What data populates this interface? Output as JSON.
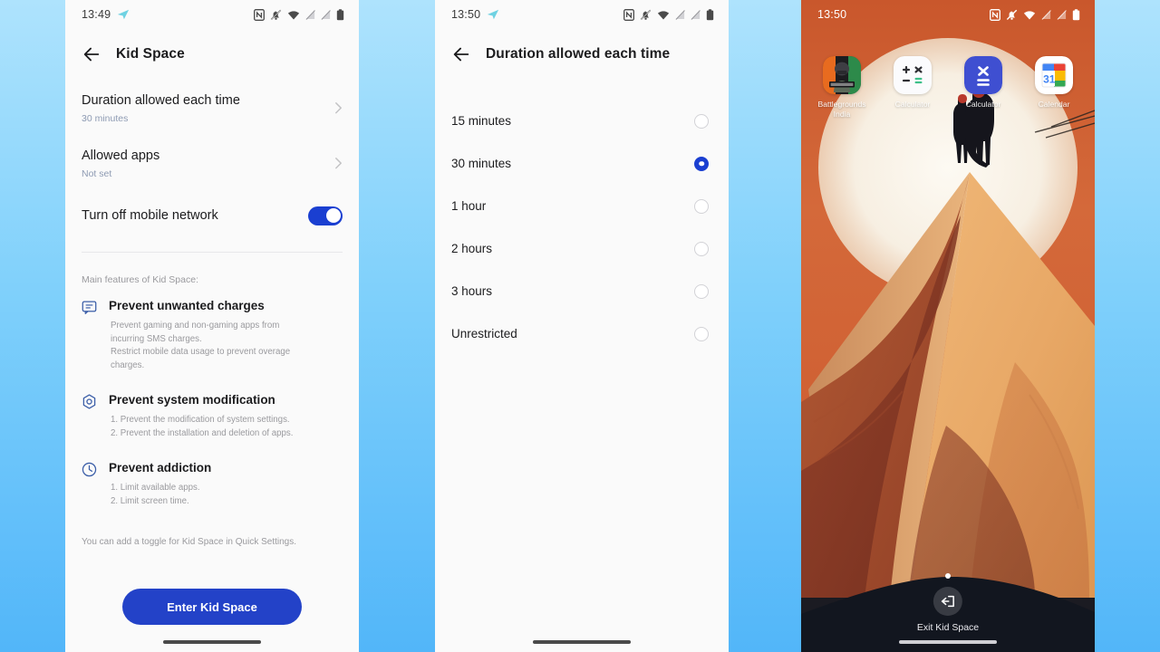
{
  "background": {
    "accent": "#7fd0fb"
  },
  "panels": {
    "settings": {
      "status": {
        "time": "13:49",
        "telegram_icon": "telegram-icon"
      },
      "appbar": {
        "back_icon": "back-arrow-icon",
        "title": "Kid Space"
      },
      "rows": [
        {
          "title": "Duration allowed each time",
          "subtitle": "30 minutes",
          "chevron": "chevron-right-icon"
        },
        {
          "title": "Allowed apps",
          "subtitle": "Not set",
          "chevron": "chevron-right-icon"
        }
      ],
      "toggle_row": {
        "title": "Turn off mobile network",
        "state": "on",
        "color": "#1a3fd1"
      },
      "features_caption": "Main features of Kid Space:",
      "features": [
        {
          "icon": "message-bubble-icon",
          "title": "Prevent unwanted charges",
          "lines": [
            "Prevent gaming and non-gaming apps from",
            "incurring SMS charges.",
            "Restrict mobile data usage to prevent overage",
            "charges."
          ]
        },
        {
          "icon": "system-hexagon-icon",
          "title": "Prevent system modification",
          "lines": [
            "1. Prevent the modification of system settings.",
            "2. Prevent the installation and deletion of apps."
          ]
        },
        {
          "icon": "clock-icon",
          "title": "Prevent addiction",
          "lines": [
            "1. Limit available apps.",
            "2. Limit screen time."
          ]
        }
      ],
      "footnote": "You can add a toggle for Kid Space in Quick Settings.",
      "cta_label": "Enter Kid Space"
    },
    "duration": {
      "status": {
        "time": "13:50",
        "telegram_icon": "telegram-icon"
      },
      "appbar": {
        "back_icon": "back-arrow-icon",
        "title": "Duration allowed each time"
      },
      "options": [
        {
          "label": "15 minutes",
          "selected": false
        },
        {
          "label": "30 minutes",
          "selected": true
        },
        {
          "label": "1 hour",
          "selected": false
        },
        {
          "label": "2 hours",
          "selected": false
        },
        {
          "label": "3 hours",
          "selected": false
        },
        {
          "label": "Unrestricted",
          "selected": false
        }
      ],
      "selected_color": "#1a3fd1"
    },
    "home": {
      "status": {
        "time": "13:50"
      },
      "apps": [
        {
          "name": "Battlegrounds India",
          "icon": "bgmi-game-icon"
        },
        {
          "name": "Calculator",
          "icon": "calculator-light-icon"
        },
        {
          "name": "Calculator",
          "icon": "calculator-blue-icon"
        },
        {
          "name": "Calendar",
          "icon": "google-calendar-icon"
        }
      ],
      "calendar_day": "31",
      "exit": {
        "label": "Exit Kid Space",
        "icon": "exit-icon"
      }
    }
  }
}
